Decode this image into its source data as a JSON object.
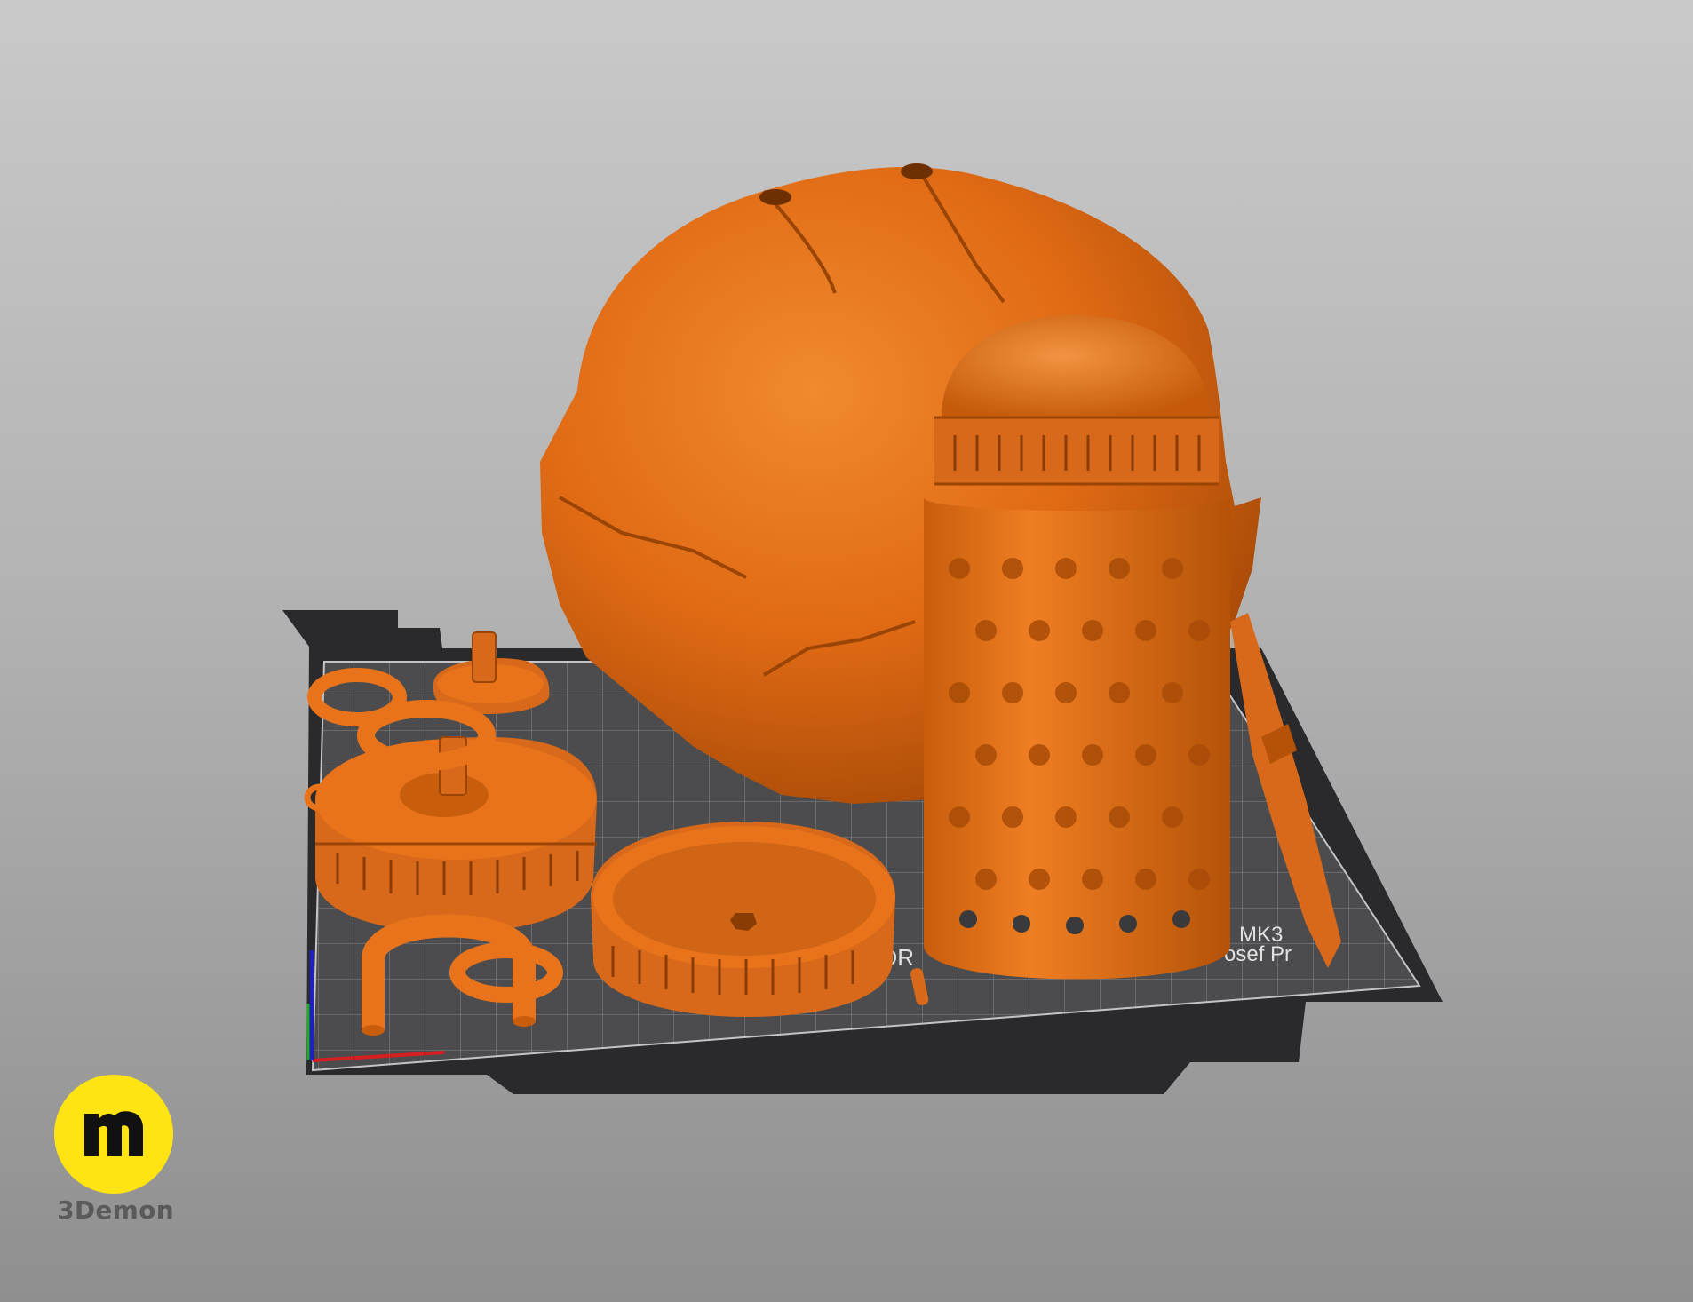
{
  "bed": {
    "label_left": "OR",
    "label_model": "MK3",
    "label_brand": "osef Pr"
  },
  "branding": {
    "name": "3Demon",
    "logo_color": "#ffe414"
  },
  "colors": {
    "background_top": "#c9c9c9",
    "background_bottom": "#8f8f8f",
    "model_orange": "#e8731a",
    "bed_surface": "#4c4c4e",
    "bed_frame": "#2a2a2c",
    "grid_lines": "#a7a7aa",
    "axis_x": "#d42020",
    "axis_y": "#1d1dd4",
    "axis_z": "#22aa22"
  },
  "icons": [
    "x-axis-icon",
    "y-axis-icon",
    "z-axis-icon",
    "3demon-logo-icon"
  ]
}
